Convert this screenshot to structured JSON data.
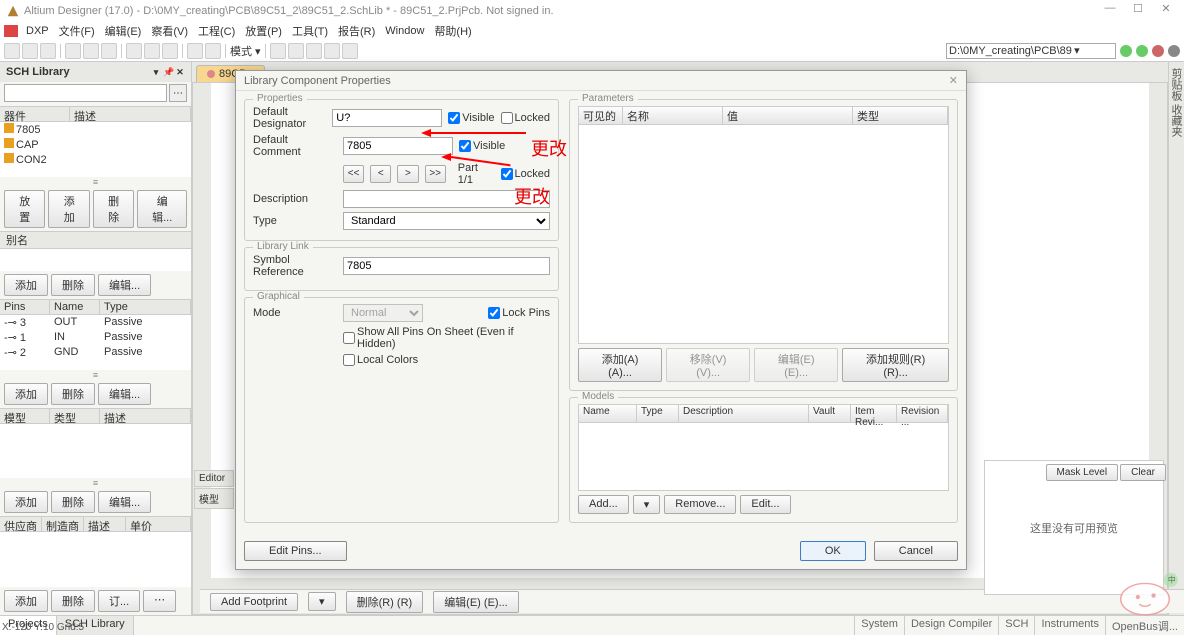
{
  "titlebar": {
    "text": "Altium Designer (17.0) - D:\\0MY_creating\\PCB\\89C51_2\\89C51_2.SchLib * - 89C51_2.PrjPcb. Not signed in."
  },
  "menubar": {
    "dxp": "DXP",
    "file": "文件(F)",
    "edit": "编辑(E)",
    "view": "察看(V)",
    "project": "工程(C)",
    "place": "放置(P)",
    "tools": "工具(T)",
    "report": "报告(R)",
    "window": "Window",
    "help": "帮助(H)"
  },
  "toolbar": {
    "mode_label": "模式 ▾",
    "path_value": "D:\\0MY_creating\\PCB\\89"
  },
  "sch_panel": {
    "title": "SCH Library",
    "col_component": "器件",
    "col_desc": "描述",
    "components": [
      "7805",
      "CAP",
      "CON2"
    ],
    "btn_place": "放置",
    "btn_add": "添加",
    "btn_del": "删除",
    "btn_edit": "编辑...",
    "alias_label": "别名",
    "pins_header": {
      "c1": "Pins",
      "c2": "Name",
      "c3": "Type"
    },
    "pins": [
      {
        "n": "-⊸ 3",
        "name": "OUT",
        "type": "Passive"
      },
      {
        "n": "-⊸ 1",
        "name": "IN",
        "type": "Passive"
      },
      {
        "n": "-⊸ 2",
        "name": "GND",
        "type": "Passive"
      }
    ],
    "model_header": {
      "c1": "模型",
      "c2": "类型",
      "c3": "描述"
    },
    "supplier_header": {
      "c1": "供应商",
      "c2": "制造商",
      "c3": "描述",
      "c4": "单价"
    },
    "btn_order": "订..."
  },
  "doc_tabs": {
    "tab1": "89C5..."
  },
  "dialog": {
    "title": "Library Component Properties",
    "grp_properties": "Properties",
    "grp_library": "Library Link",
    "grp_graphical": "Graphical",
    "grp_parameters": "Parameters",
    "grp_models": "Models",
    "lbl_designator": "Default Designator",
    "val_designator": "U?",
    "lbl_comment": "Default Comment",
    "val_comment": "7805",
    "lbl_description": "Description",
    "val_description": "",
    "lbl_type": "Type",
    "val_type": "Standard",
    "chk_visible": "Visible",
    "chk_locked": "Locked",
    "part_nav": "Part 1/1",
    "nav_first": "<<",
    "nav_prev": "<",
    "nav_next": ">",
    "nav_last": ">>",
    "lbl_symbol": "Symbol Reference",
    "val_symbol": "7805",
    "lbl_mode": "Mode",
    "val_mode": "Normal",
    "chk_lockpins": "Lock Pins",
    "chk_showall": "Show All Pins On Sheet (Even if Hidden)",
    "chk_localcolors": "Local Colors",
    "param_cols": {
      "visible": "可见的",
      "name": "名称",
      "value": "值",
      "type": "类型"
    },
    "btn_add_a": "添加(A) (A)...",
    "btn_move_v": "移除(V) (V)...",
    "btn_edit_e": "编辑(E) (E)...",
    "btn_addrule": "添加规则(R) (R)...",
    "model_cols": {
      "name": "Name",
      "type": "Type",
      "desc": "Description",
      "vault": "Vault",
      "item": "Item Revi...",
      "rev": "Revision ..."
    },
    "btn_model_add": "Add...",
    "btn_model_remove": "Remove...",
    "btn_model_edit": "Edit...",
    "btn_editpins": "Edit Pins...",
    "btn_ok": "OK",
    "btn_cancel": "Cancel"
  },
  "annotations": {
    "change1": "更改",
    "change2": "更改"
  },
  "right_panel": {
    "no_preview": "这里没有可用预览",
    "mask": "Mask Level",
    "clear": "Clear"
  },
  "editor": {
    "tab1": "Editor",
    "tab2": "模型"
  },
  "bottom": {
    "add_footprint": "Add Footprint",
    "del": "删除(R) (R)",
    "edit": "编辑(E) (E)..."
  },
  "statusbar": {
    "left_tabs": [
      "Projects",
      "SCH Library"
    ],
    "coord": "X:-120 Y:10   Grid:5",
    "right": [
      "System",
      "Design Compiler",
      "SCH",
      "Instruments",
      "OpenBus调..."
    ]
  },
  "right_strip": {
    "text": "剪贴板   收藏夹"
  }
}
